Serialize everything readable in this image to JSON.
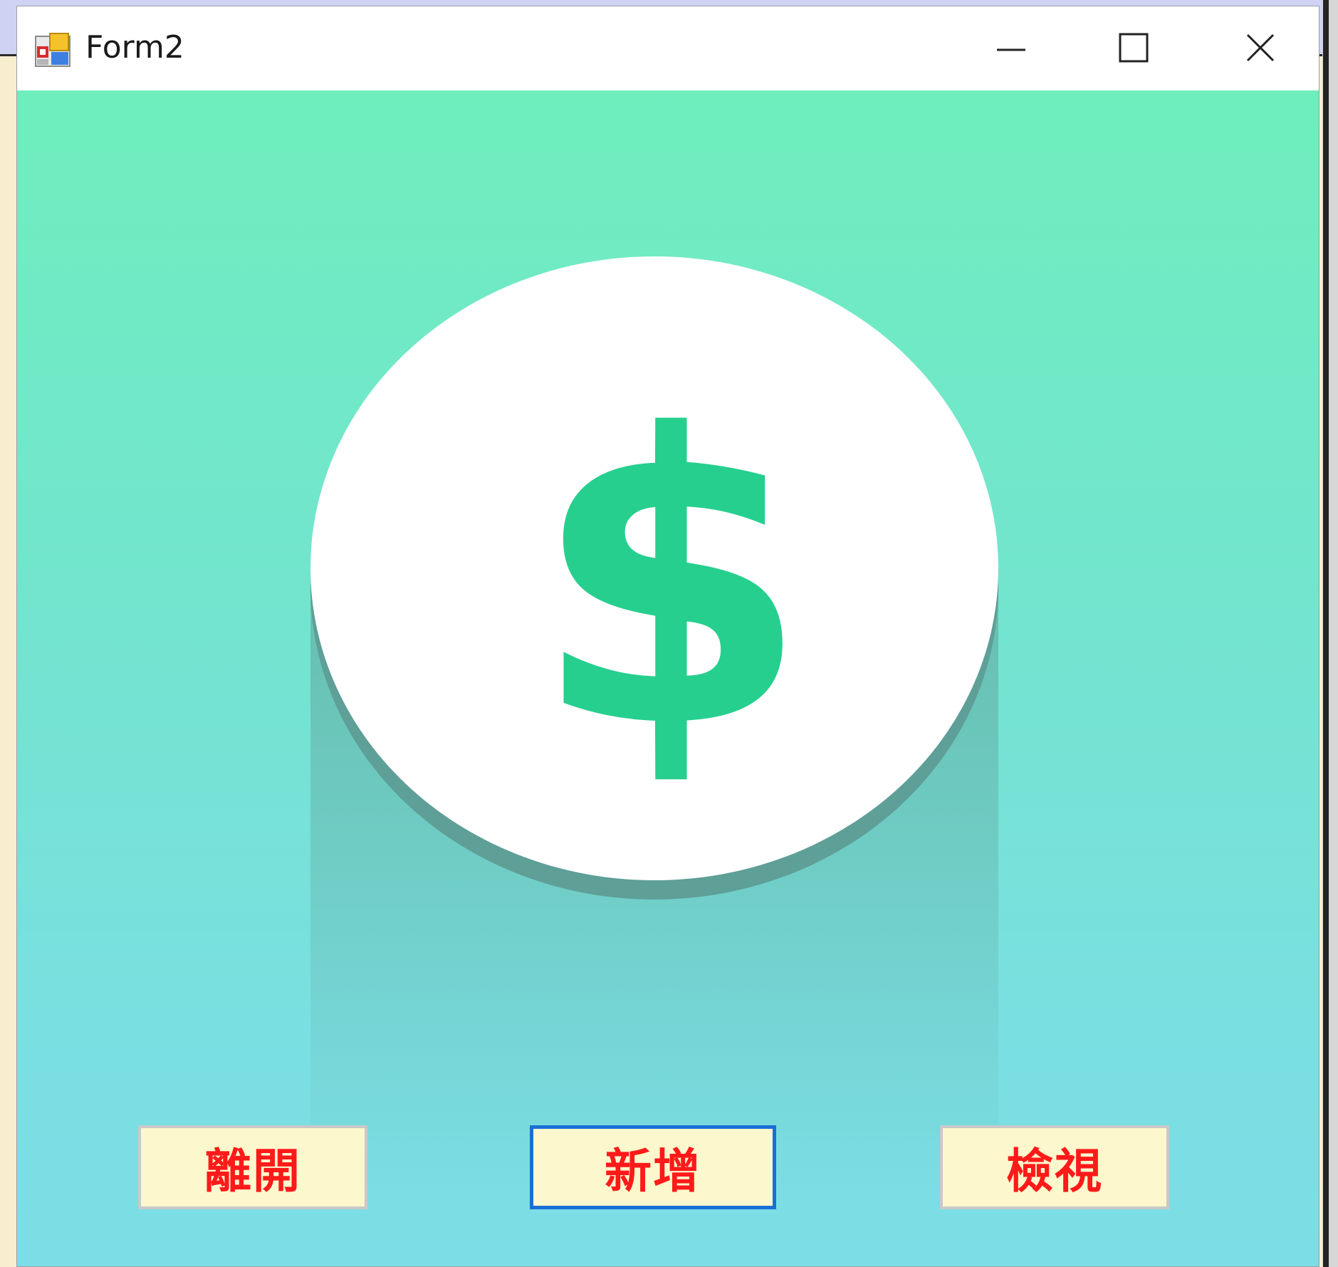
{
  "window": {
    "title": "Form2",
    "icon": "winforms-app-icon",
    "controls": {
      "minimize": "minimize-icon",
      "maximize": "maximize-icon",
      "close": "close-icon"
    }
  },
  "graphic": {
    "symbol": "$",
    "icon": "dollar-coin-icon",
    "colors": {
      "coin": "#ffffff",
      "symbol": "#27cf8f",
      "shadow": "#5f9f98",
      "background_top": "#6eeebd",
      "background_bottom": "#7cdde6"
    }
  },
  "buttons": {
    "exit_label": "離開",
    "add_label": "新增",
    "view_label": "檢視",
    "label_color": "#ff1a1a",
    "background": "#fdf7cd",
    "focused_border": "#1a6fd6"
  }
}
